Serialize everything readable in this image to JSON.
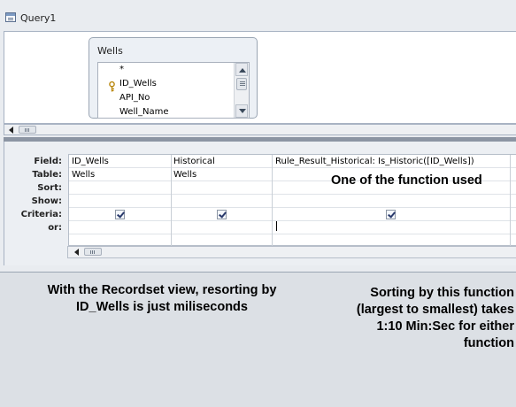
{
  "window": {
    "title": "Query1"
  },
  "table_box": {
    "title": "Wells",
    "fields": [
      "*",
      "ID_Wells",
      "API_No",
      "Well_Name"
    ],
    "key_field_index": 1
  },
  "design_grid": {
    "row_labels": [
      "Field:",
      "Table:",
      "Sort:",
      "Show:",
      "Criteria:",
      "or:"
    ],
    "columns": [
      {
        "field": "ID_Wells",
        "table": "Wells",
        "sort": "",
        "show": true,
        "criteria": "",
        "or": ""
      },
      {
        "field": "Historical",
        "table": "Wells",
        "sort": "",
        "show": true,
        "criteria": "",
        "or": ""
      },
      {
        "field": "Rule_Result_Historical: Is_Historic([ID_Wells])",
        "table": "",
        "sort": "",
        "show": true,
        "criteria": "",
        "or": ""
      }
    ]
  },
  "annotations": {
    "function_note": "One of the function used",
    "left_note": [
      "With the Recordset view, resorting by",
      "ID_Wells is just miliseconds"
    ],
    "right_note": [
      "Sorting by this function",
      "(largest to smallest) takes",
      "1:10 Min:Sec for either",
      "function"
    ]
  },
  "icons": {
    "window": "query-icon",
    "key": "primary-key-icon",
    "scroll_up": "scroll-up-arrow-icon",
    "scroll_down": "scroll-down-arrow-icon",
    "scroll_left": "scroll-left-arrow-icon",
    "checkbox": "checkbox-checked-icon"
  }
}
